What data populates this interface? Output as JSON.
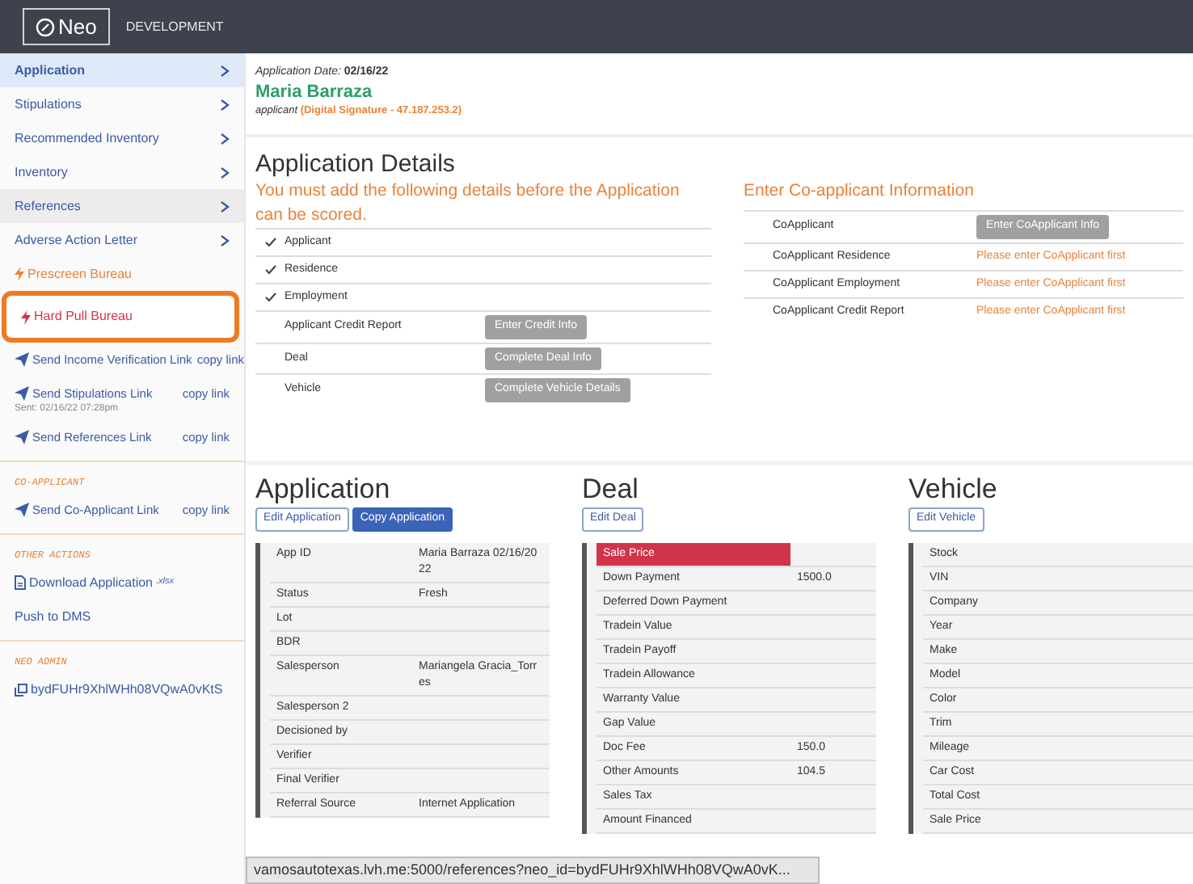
{
  "topbar": {
    "logo": "Neo",
    "environment": "DEVELOPMENT"
  },
  "sidebar": {
    "sections": [
      {
        "items": [
          {
            "kind": "nav",
            "label": "Application",
            "selected": true,
            "hovered": false
          },
          {
            "kind": "nav",
            "label": "Stipulations",
            "selected": false,
            "hovered": false
          },
          {
            "kind": "nav",
            "label": "Recommended Inventory",
            "selected": false,
            "hovered": false
          },
          {
            "kind": "nav",
            "label": "Inventory",
            "selected": false,
            "hovered": false
          },
          {
            "kind": "nav",
            "label": "References",
            "selected": false,
            "hovered": true
          },
          {
            "kind": "nav",
            "label": "Adverse Action Letter",
            "selected": false,
            "hovered": false
          },
          {
            "kind": "bureau",
            "label": "Prescreen Bureau",
            "color": "#e8833a",
            "outlined": false
          },
          {
            "kind": "bureau",
            "label": "Hard Pull Bureau",
            "color": "#d0344a",
            "outlined": true
          },
          {
            "kind": "send",
            "label": "Send Income Verification Link",
            "copy": "copy link"
          },
          {
            "kind": "send",
            "label": "Send Stipulations Link",
            "copy": "copy link",
            "sent": "Sent: 02/16/22 07:28pm"
          },
          {
            "kind": "send",
            "label": "Send References Link",
            "copy": "copy link"
          }
        ]
      },
      {
        "heading": "CO-APPLICANT",
        "items": [
          {
            "kind": "send",
            "label": "Send Co-Applicant Link",
            "copy": "copy link"
          }
        ]
      },
      {
        "heading": "OTHER ACTIONS",
        "items": [
          {
            "kind": "download",
            "label": "Download Application",
            "suffix": ".xlsx"
          },
          {
            "kind": "plain",
            "label": "Push to DMS"
          }
        ]
      },
      {
        "heading": "NEO ADMIN",
        "items": [
          {
            "kind": "copy_id",
            "label": "bydFUHr9XhlWHh08VQwA0vKtS"
          }
        ]
      }
    ]
  },
  "header": {
    "date_label": "Application Date:",
    "date": "02/16/22",
    "name": "Maria Barraza",
    "role": "applicant",
    "signature": "(Digital Signature - 47.187.253.2)"
  },
  "details": {
    "title": "Application Details",
    "warning": "You must add the following details before the Application can be scored.",
    "checklist": [
      {
        "label": "Applicant",
        "checked": true
      },
      {
        "label": "Residence",
        "checked": true
      },
      {
        "label": "Employment",
        "checked": true
      },
      {
        "label": "Applicant Credit Report",
        "checked": false,
        "action": "Enter Credit Info"
      },
      {
        "label": "Deal",
        "checked": false,
        "action": "Complete Deal Info"
      },
      {
        "label": "Vehicle",
        "checked": false,
        "action": "Complete Vehicle Details"
      }
    ]
  },
  "coapplicant": {
    "title": "Enter Co-applicant Information",
    "rows": [
      {
        "label": "CoApplicant",
        "action": "Enter CoApplicant Info"
      },
      {
        "label": "CoApplicant Residence",
        "note": "Please enter CoApplicant first"
      },
      {
        "label": "CoApplicant Employment",
        "note": "Please enter CoApplicant first"
      },
      {
        "label": "CoApplicant Credit Report",
        "note": "Please enter CoApplicant first"
      }
    ]
  },
  "panels": [
    {
      "title": "Application",
      "buttons": [
        {
          "label": "Edit Application",
          "primary": false
        },
        {
          "label": "Copy Application",
          "primary": true
        }
      ],
      "rows": [
        {
          "label": "App ID",
          "value": "Maria Barraza 02/16/2022",
          "alert": false
        },
        {
          "label": "Status",
          "value": "Fresh",
          "alert": false
        },
        {
          "label": "Lot",
          "alert": false
        },
        {
          "label": "BDR",
          "alert": false
        },
        {
          "label": "Salesperson",
          "value": "Mariangela Gracia_Torres",
          "alert": false
        },
        {
          "label": "Salesperson 2",
          "alert": false
        },
        {
          "label": "Decisioned by",
          "alert": false
        },
        {
          "label": "Verifier",
          "alert": false
        },
        {
          "label": "Final Verifier",
          "alert": false
        },
        {
          "label": "Referral Source",
          "value": "Internet Application",
          "alert": false
        }
      ]
    },
    {
      "title": "Deal",
      "buttons": [
        {
          "label": "Edit Deal",
          "primary": false
        }
      ],
      "rows": [
        {
          "label": "Sale Price",
          "alert": true
        },
        {
          "label": "Down Payment",
          "value": "1500.0",
          "alert": false
        },
        {
          "label": "Deferred Down Payment",
          "alert": false
        },
        {
          "label": "Tradein Value",
          "alert": false
        },
        {
          "label": "Tradein Payoff",
          "alert": false
        },
        {
          "label": "Tradein Allowance",
          "alert": false
        },
        {
          "label": "Warranty Value",
          "alert": false
        },
        {
          "label": "Gap Value",
          "alert": false
        },
        {
          "label": "Doc Fee",
          "value": "150.0",
          "alert": false
        },
        {
          "label": "Other Amounts",
          "value": "104.5",
          "alert": false
        },
        {
          "label": "Sales Tax",
          "alert": false
        },
        {
          "label": "Amount Financed",
          "alert": false
        }
      ]
    },
    {
      "title": "Vehicle",
      "buttons": [
        {
          "label": "Edit Vehicle",
          "primary": false
        }
      ],
      "rows": [
        {
          "label": "Stock",
          "alert": false
        },
        {
          "label": "VIN",
          "alert": false
        },
        {
          "label": "Company",
          "alert": false
        },
        {
          "label": "Year",
          "alert": false
        },
        {
          "label": "Make",
          "alert": false
        },
        {
          "label": "Model",
          "alert": false
        },
        {
          "label": "Color",
          "alert": false
        },
        {
          "label": "Trim",
          "alert": false
        },
        {
          "label": "Mileage",
          "alert": false
        },
        {
          "label": "Car Cost",
          "alert": false
        },
        {
          "label": "Total Cost",
          "alert": false
        },
        {
          "label": "Sale Price",
          "alert": false
        }
      ]
    }
  ],
  "status_bar": {
    "url": "vamosautotexas.lvh.me:5000/references?neo_id=bydFUHr9XhlWHh08VQwA0vK..."
  }
}
